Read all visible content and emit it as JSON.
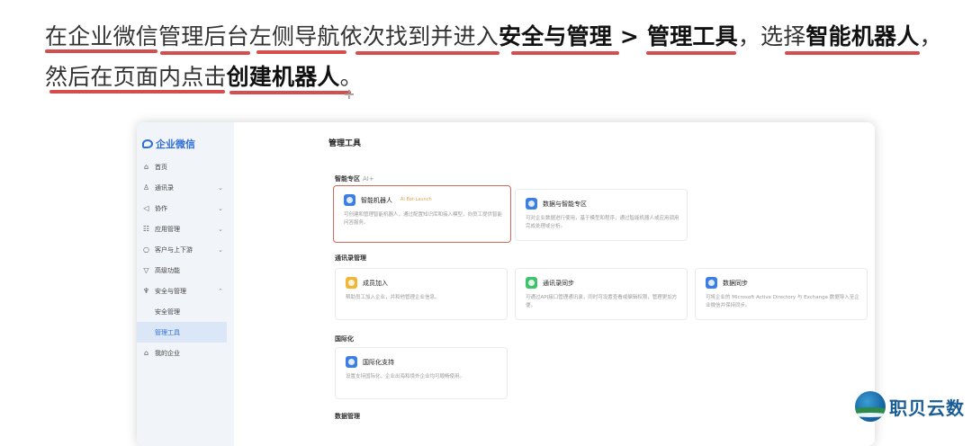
{
  "instruction": {
    "p1": "在企业微信管理后台左侧导航依次找到并进入",
    "b1": "安全与管理",
    "sep": " > ",
    "b2": "管理工具",
    "p2": "，选择",
    "b3": "智能机器人",
    "p3": "，",
    "p4": "然后在页面内点击",
    "b4": "创建机器人",
    "p5": "。"
  },
  "app": {
    "logo_text": "企业微信",
    "page_title": "管理工具"
  },
  "sidebar": {
    "items": [
      {
        "icon": "⌂",
        "label": "首页",
        "chev": ""
      },
      {
        "icon": "♙",
        "label": "通讯录",
        "chev": "⌄"
      },
      {
        "icon": "◁",
        "label": "协作",
        "chev": "⌄"
      },
      {
        "icon": "☷",
        "label": "应用管理",
        "chev": "⌄"
      },
      {
        "icon": "○",
        "label": "客户与上下游",
        "chev": "⌄"
      },
      {
        "icon": "▽",
        "label": "高级功能",
        "chev": ""
      },
      {
        "icon": "♆",
        "label": "安全与管理",
        "chev": "⌃"
      },
      {
        "icon": "",
        "label": "安全管理",
        "chev": ""
      },
      {
        "icon": "",
        "label": "管理工具",
        "chev": ""
      },
      {
        "icon": "⌂",
        "label": "我的企业",
        "chev": ""
      }
    ]
  },
  "sections": {
    "ai": {
      "title": "智能专区",
      "tag": "AI+"
    },
    "contacts": {
      "title": "通讯录管理"
    },
    "intl": {
      "title": "国际化"
    },
    "data": {
      "title": "数据管理"
    }
  },
  "tiles": {
    "robot": {
      "title": "智能机器人",
      "badge": "AI Bot·Launch",
      "desc": "可创建和管理智能机器人，通过配置知识库和接入模型，向员工提供智能问答服务。",
      "icon": "robot-icon",
      "color": "#3b7ee5"
    },
    "data_ai": {
      "title": "数据与智能专区",
      "desc": "可对企业数据进行使用，基于模型和程序，通过智能机器人或应用调用完成处理或分析。",
      "icon": "data-icon",
      "color": "#3b7ee5"
    },
    "member_join": {
      "title": "成员加入",
      "desc": "帮助员工加入企业，并和他管理企业信息。",
      "icon": "member-icon",
      "color": "#f2b634"
    },
    "contact_sync": {
      "title": "通讯录同步",
      "desc": "可通过API接口管理通讯录，同时可设置查看或编辑权限，管理更加方便。",
      "icon": "sync-icon",
      "color": "#3ec26a"
    },
    "data_sync": {
      "title": "数据同步",
      "desc": "可将企业的 Microsoft Active Directory 与 Exchange 数据导入至企业微信并保持同步。",
      "icon": "folder-icon",
      "color": "#3b7ee5"
    },
    "intl_support": {
      "title": "国际化支持",
      "desc": "设置支持国际化，企业出海和境外企业均可顺畅使用。",
      "icon": "globe-icon",
      "color": "#3b7ee5"
    }
  },
  "watermark": {
    "text": "职贝云数"
  }
}
